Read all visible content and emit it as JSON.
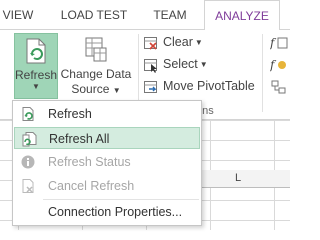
{
  "tabs": [
    {
      "label": "VIEW"
    },
    {
      "label": "LOAD TEST"
    },
    {
      "label": "TEAM"
    },
    {
      "label": "ANALYZE"
    }
  ],
  "ribbon": {
    "refresh_label": "Refresh",
    "change_source_line1": "Change Data",
    "change_source_line2": "Source",
    "clear_label": "Clear",
    "select_label": "Select",
    "move_pivot_label": "Move PivotTable",
    "group_label_partial": "ons"
  },
  "sheet": {
    "column_letter": "L"
  },
  "menu": {
    "items": [
      {
        "label": "Refresh",
        "icon": "refresh-icon",
        "state": "normal"
      },
      {
        "label": "Refresh All",
        "icon": "refresh-all-icon",
        "state": "hover"
      },
      {
        "label": "Refresh Status",
        "icon": "info-icon",
        "state": "disabled"
      },
      {
        "label": "Cancel Refresh",
        "icon": "cancel-refresh-icon",
        "state": "disabled"
      },
      {
        "label": "Connection Properties...",
        "icon": "",
        "state": "normal"
      }
    ]
  },
  "colors": {
    "accent_tab": "#7f3c9a",
    "refresh_button_bg": "#9fd5b7",
    "menu_hover_bg": "#d4ecdf"
  }
}
